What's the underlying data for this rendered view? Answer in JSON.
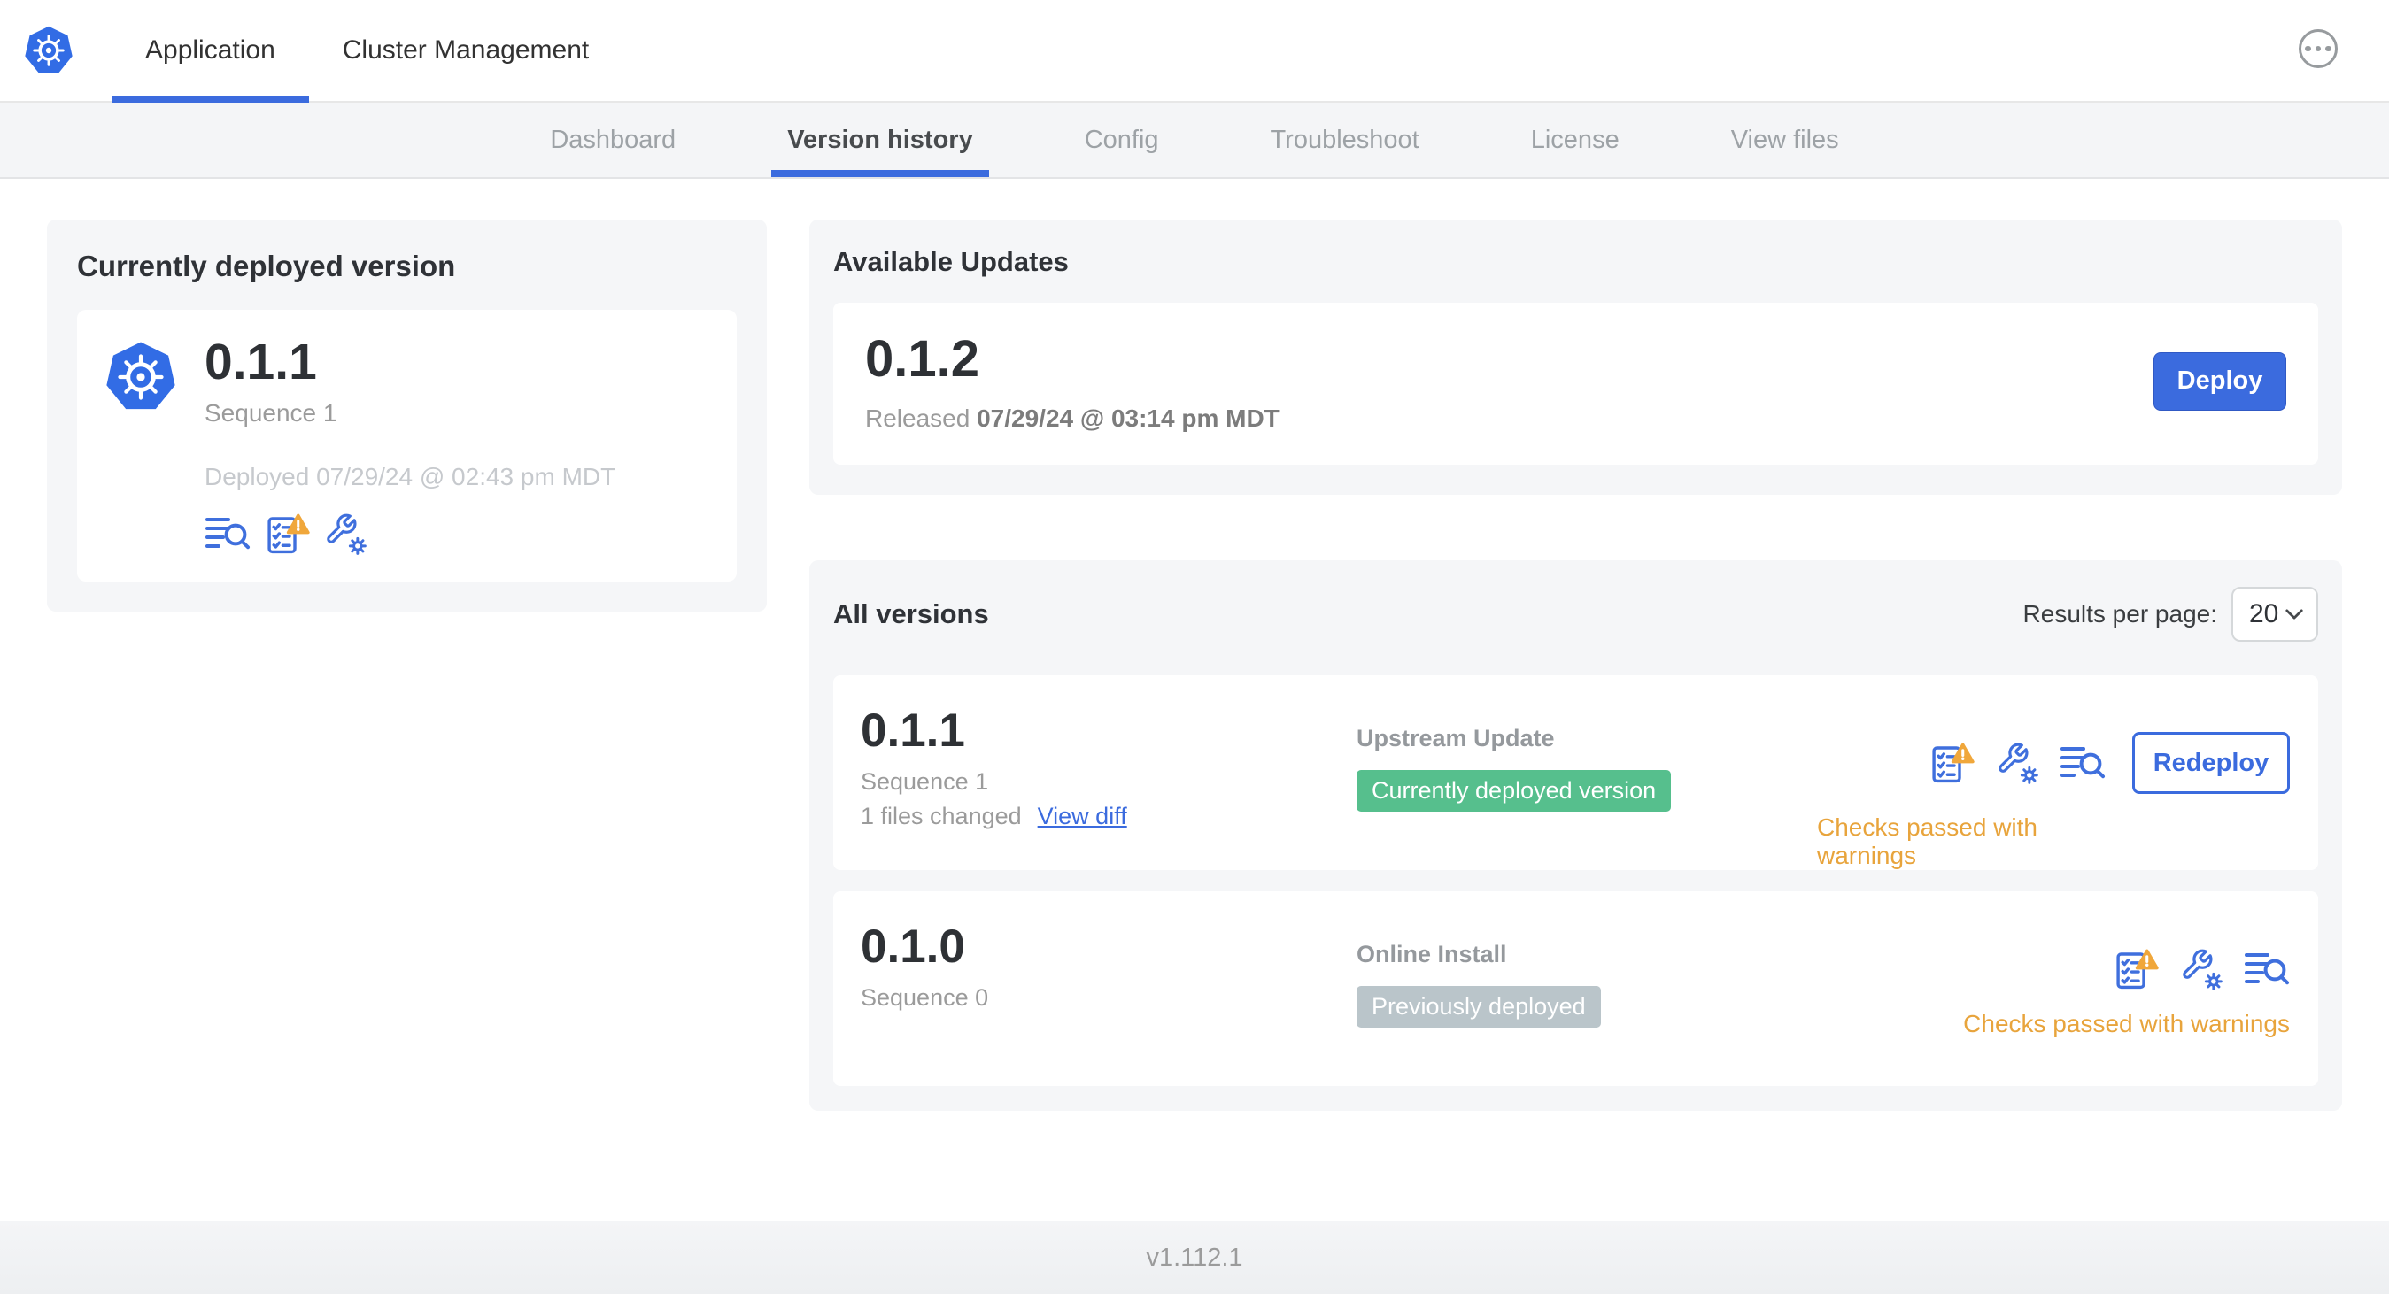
{
  "header": {
    "tabs": [
      {
        "label": "Application"
      },
      {
        "label": "Cluster Management"
      }
    ]
  },
  "nav": {
    "tabs": [
      {
        "label": "Dashboard"
      },
      {
        "label": "Version history"
      },
      {
        "label": "Config"
      },
      {
        "label": "Troubleshoot"
      },
      {
        "label": "License"
      },
      {
        "label": "View files"
      }
    ]
  },
  "current_version": {
    "title": "Currently deployed version",
    "version": "0.1.1",
    "sequence": "Sequence 1",
    "deployed": "Deployed 07/29/24 @ 02:43 pm MDT"
  },
  "available_updates": {
    "title": "Available Updates",
    "version": "0.1.2",
    "released_prefix": "Released",
    "released_date": "07/29/24 @ 03:14 pm MDT",
    "deploy_label": "Deploy"
  },
  "all_versions": {
    "title": "All versions",
    "results_per_page_label": "Results per page:",
    "results_per_page_value": "20",
    "rows": [
      {
        "version": "0.1.1",
        "sequence": "Sequence 1",
        "files_changed": "1 files changed",
        "view_diff": "View diff",
        "source": "Upstream Update",
        "badge": "Currently deployed version",
        "checks": "Checks passed with warnings",
        "action": "Redeploy"
      },
      {
        "version": "0.1.0",
        "sequence": "Sequence 0",
        "source": "Online Install",
        "badge": "Previously deployed",
        "checks": "Checks passed with warnings"
      }
    ]
  },
  "footer": {
    "version": "v1.112.1"
  },
  "colors": {
    "accent_blue": "#3b6bde",
    "logo_blue": "#326ce5",
    "success_green": "#56bf8d",
    "badge_gray": "#bac5ca",
    "warning_orange": "#e8a43c",
    "panel_gray": "#f5f6f8"
  },
  "icons": {
    "logo": "kubernetes-logo",
    "menu": "ellipsis-menu",
    "release_notes": "lines-with-magnifier-search",
    "preflight": "checklist-with-warning-triangle",
    "config": "wrench-with-gear",
    "chevron": "chevron-down"
  }
}
